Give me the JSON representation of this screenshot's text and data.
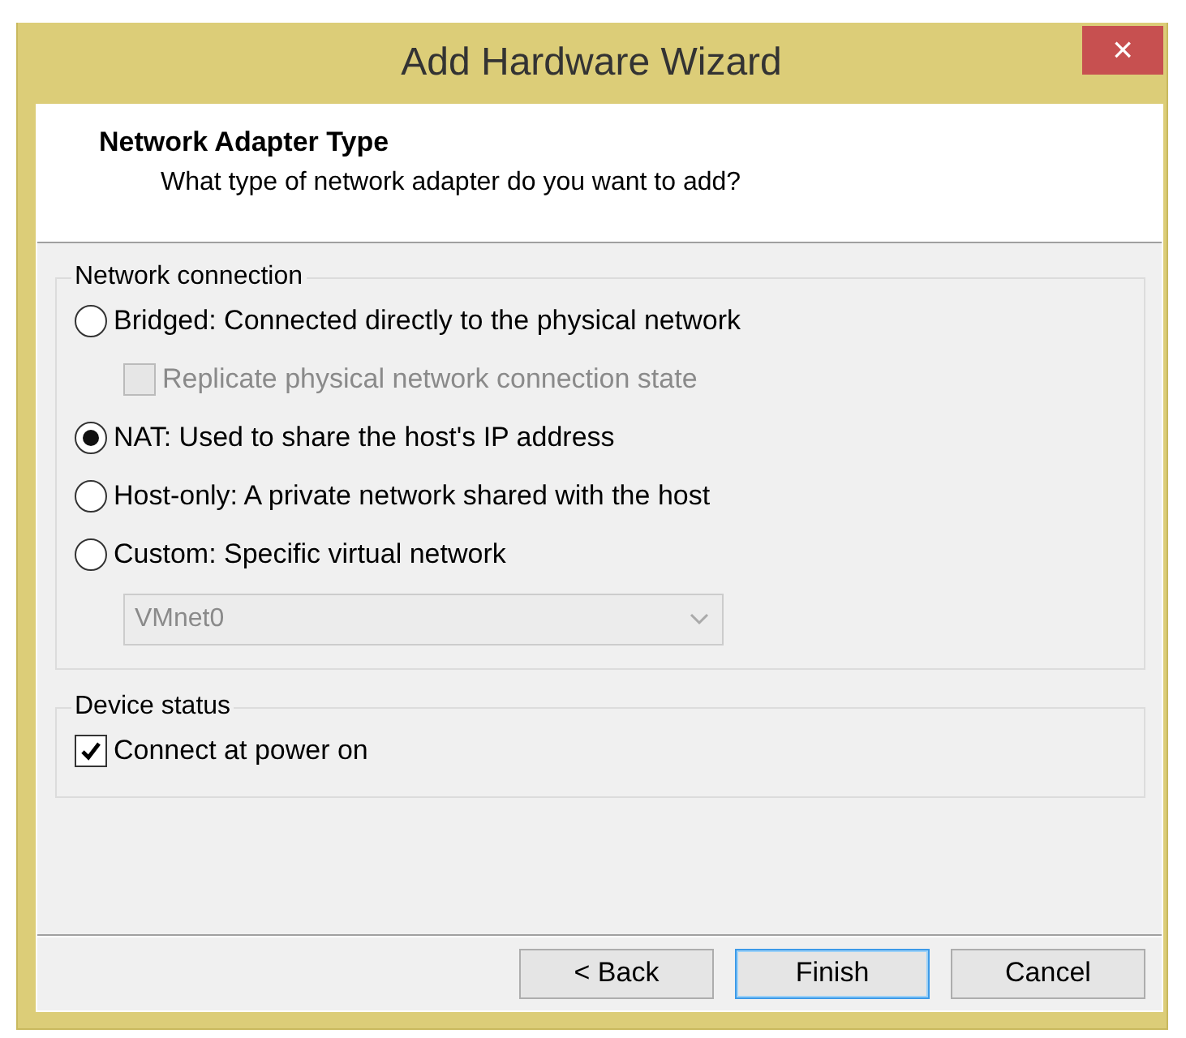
{
  "window": {
    "title": "Add Hardware Wizard",
    "close": "×"
  },
  "header": {
    "title": "Network Adapter Type",
    "subtitle": "What type of network adapter do you want to add?"
  },
  "network_connection": {
    "label": "Network connection",
    "options": [
      {
        "kind": "radio",
        "label": "Bridged: Connected directly to the physical network",
        "selected": false,
        "children": [
          {
            "kind": "checkbox",
            "label": "Replicate physical network connection state",
            "checked": false,
            "disabled": true
          }
        ]
      },
      {
        "kind": "radio",
        "label": "NAT: Used to share the host's IP address",
        "selected": true
      },
      {
        "kind": "radio",
        "label": "Host-only: A private network shared with the host",
        "selected": false
      },
      {
        "kind": "radio",
        "label": "Custom: Specific virtual network",
        "selected": false,
        "children": [
          {
            "kind": "dropdown",
            "value": "VMnet0",
            "disabled": true
          }
        ]
      }
    ]
  },
  "device_status": {
    "label": "Device status",
    "options": [
      {
        "kind": "checkbox",
        "label": "Connect at power on",
        "checked": true,
        "disabled": false
      }
    ]
  },
  "buttons": [
    {
      "label": "< Back",
      "default": false
    },
    {
      "label": "Finish",
      "default": true
    },
    {
      "label": "Cancel",
      "default": false
    }
  ]
}
